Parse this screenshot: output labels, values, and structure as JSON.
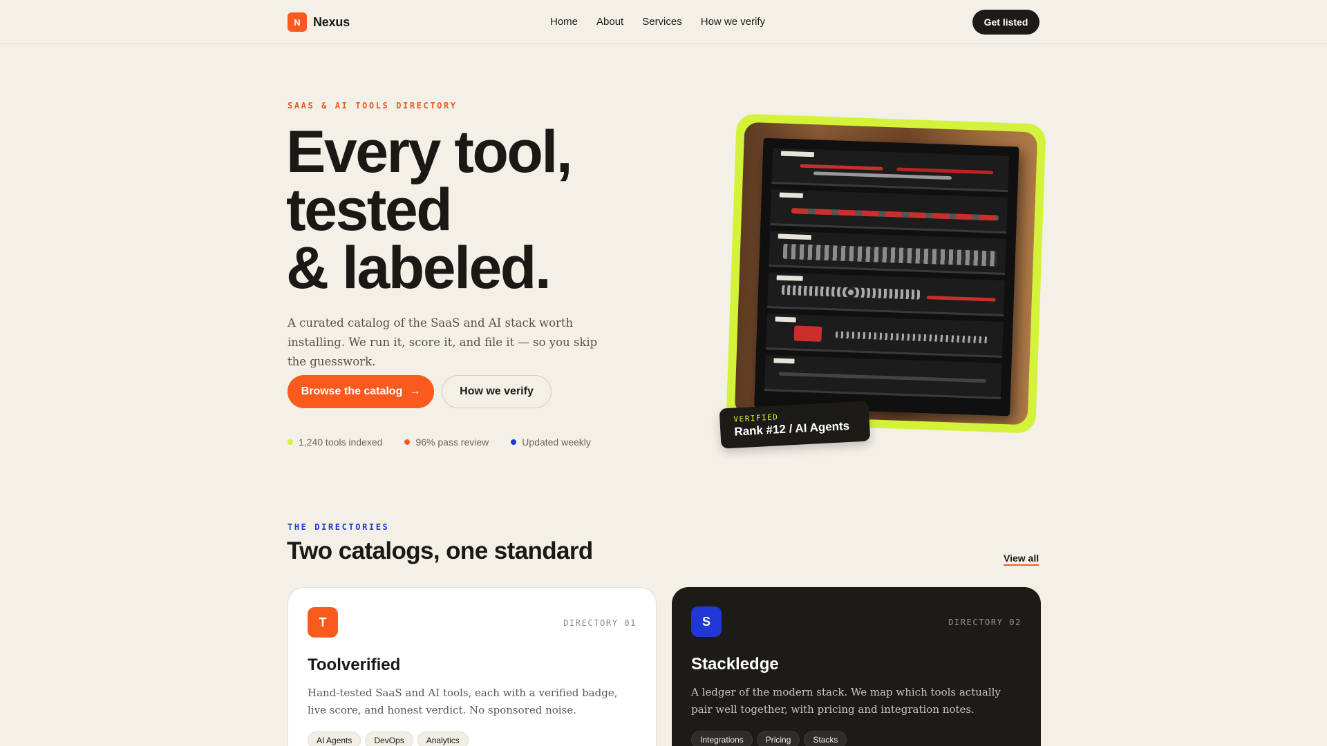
{
  "header": {
    "logo_letter": "N",
    "brand": "Nexus",
    "nav": [
      "Home",
      "About",
      "Services",
      "How we verify"
    ],
    "cta": "Get listed"
  },
  "hero": {
    "eyebrow": "SAAS & AI TOOLS DIRECTORY",
    "title_lines": [
      "Every tool,",
      "tested",
      "& labeled."
    ],
    "subtitle": "A curated catalog of the SaaS and AI stack worth installing. We run it, score it, and file it — so you skip the guesswork.",
    "primary_button": "Browse the catalog",
    "primary_arrow": "→",
    "secondary_button": "How we verify",
    "stats": [
      {
        "label": "1,240 tools indexed",
        "color": "#d4f23a"
      },
      {
        "label": "96% pass review",
        "color": "#fa5a1e"
      },
      {
        "label": "Updated weekly",
        "color": "#2238d6"
      }
    ],
    "badge_key": "VERIFIED",
    "badge_value": "Rank #12 / AI Agents"
  },
  "directories": {
    "eyebrow": "THE DIRECTORIES",
    "title": "Two catalogs, one standard",
    "view_all": "View all",
    "cards": [
      {
        "letter": "T",
        "icon_color": "#fa5a1e",
        "number": "DIRECTORY 01",
        "title": "Toolverified",
        "description": "Hand-tested SaaS and AI tools, each with a verified badge, live score, and honest verdict. No sponsored noise.",
        "tags": [
          "AI Agents",
          "DevOps",
          "Analytics"
        ]
      },
      {
        "letter": "S",
        "icon_color": "#2238d6",
        "number": "DIRECTORY 02",
        "title": "Stackledge",
        "description": "A ledger of the modern stack. We map which tools actually pair well together, with pricing and integration notes.",
        "tags": [
          "Integrations",
          "Pricing",
          "Stacks"
        ]
      }
    ]
  }
}
